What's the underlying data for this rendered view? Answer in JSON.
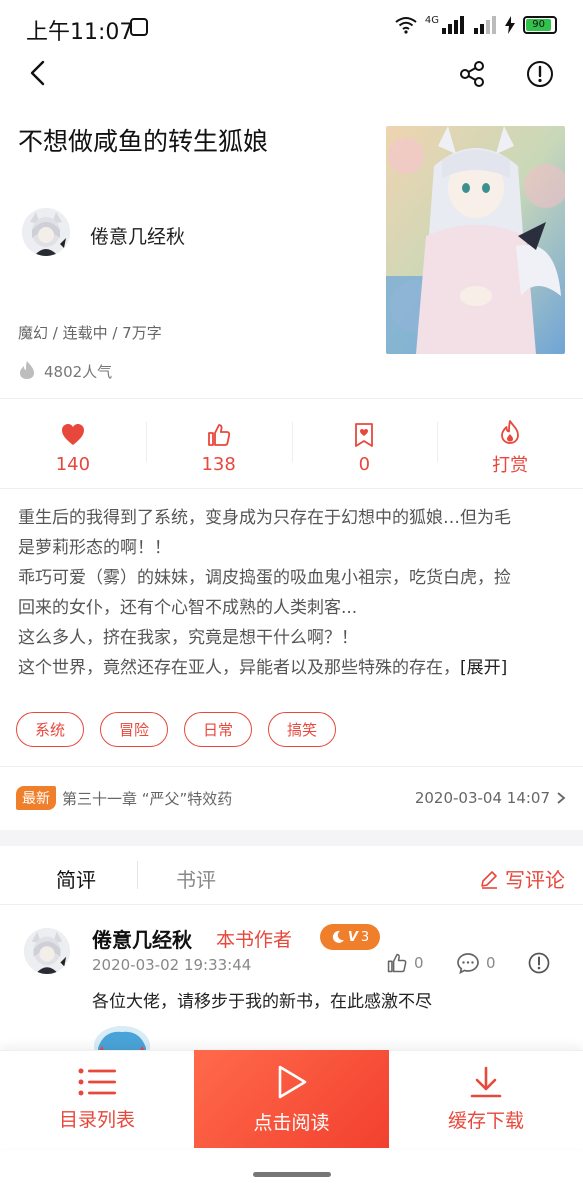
{
  "status_bar": {
    "time": "上午11:07",
    "network": "4G",
    "battery": "90"
  },
  "book": {
    "title": "不想做咸鱼的转生狐娘",
    "author": "倦意几经秋",
    "meta": "魔幻 / 连载中 / 7万字",
    "popularity": "4802人气"
  },
  "stats": {
    "favorites": "140",
    "likes": "138",
    "tickets": "0",
    "reward_label": "打赏"
  },
  "synopsis": {
    "lines": [
      "重生后的我得到了系统，变身成为只存在于幻想中的狐娘…但为毛",
      "是萝莉形态的啊！！",
      "乖巧可爱（雾）的妹妹，调皮捣蛋的吸血鬼小祖宗，吃货白虎，捡",
      "回来的女仆，还有个心智不成熟的人类刺客...",
      "这么多人，挤在我家，究竟是想干什么啊？！",
      "这个世界，竟然还存在亚人，异能者以及那些特殊的存在，"
    ],
    "expand_label": "[展开]"
  },
  "tags": [
    "系统",
    "冒险",
    "日常",
    "搞笑"
  ],
  "latest": {
    "badge": "最新",
    "chapter": "第三十一章 “严父”特效药",
    "date": "2020-03-04 14:07"
  },
  "review_tabs": {
    "short": "简评",
    "book": "书评",
    "write": "写评论"
  },
  "comment": {
    "user": "倦意几经秋",
    "role": "本书作者",
    "level": "3",
    "date": "2020-03-02 19:33:44",
    "likes": "0",
    "replies": "0",
    "text": "各位大佬，请移步于我的新书，在此感激不尽"
  },
  "bottom_bar": {
    "catalog": "目录列表",
    "read": "点击阅读",
    "download": "缓存下载"
  },
  "colors": {
    "accent": "#e8483c",
    "orange": "#f07f2c"
  }
}
